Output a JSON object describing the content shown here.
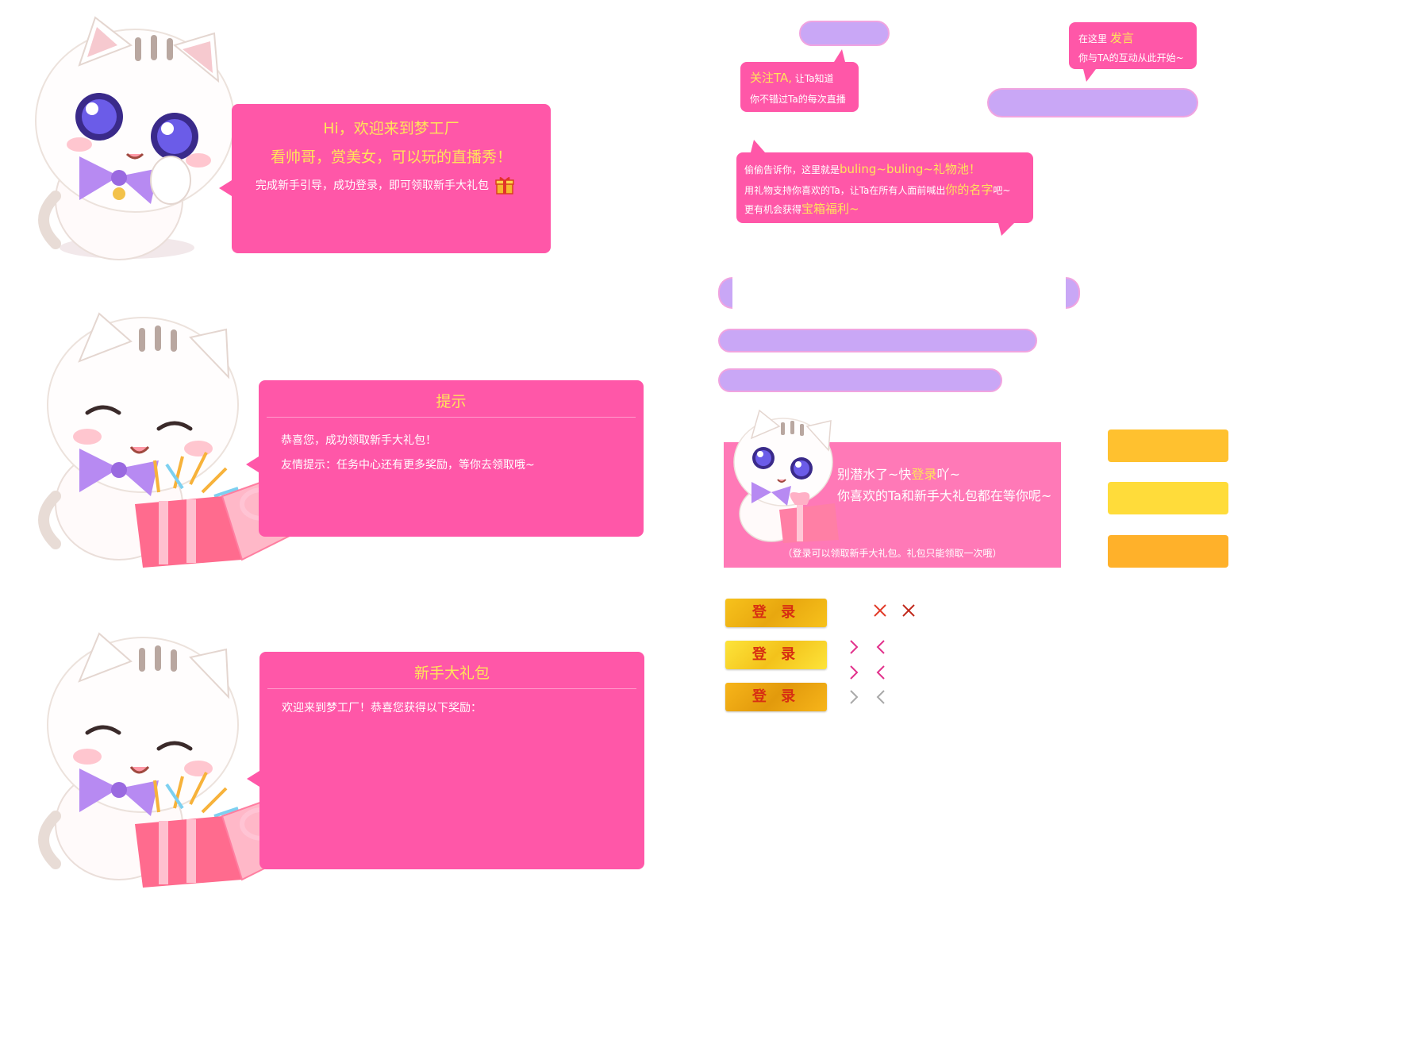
{
  "welcome": {
    "line1": "Hi，欢迎来到梦工厂",
    "line2": "看帅哥，赏美女，可以玩的直播秀！",
    "line3": "完成新手引导，成功登录，即可领取新手大礼包"
  },
  "tip_dialog": {
    "title": "提示",
    "line1": "恭喜您，成功领取新手大礼包！",
    "line2": "友情提示：任务中心还有更多奖励，等你去领取哦~"
  },
  "gift_dialog": {
    "title": "新手大礼包",
    "line1": "欢迎来到梦工厂！恭喜您获得以下奖励："
  },
  "follow_bubble": {
    "highlight": "关注TA,",
    "rest1": " 让Ta知道",
    "line2": "你不错过Ta的每次直播"
  },
  "speak_bubble": {
    "prefix": "在这里 ",
    "highlight": "发言",
    "line2": "你与TA的互动从此开始~"
  },
  "gift_pool_bubble": {
    "l1_prefix": "偷偷告诉你，这里就是",
    "l1_highlight": "buling~buling~礼物池！",
    "l2_prefix": "用礼物支持你喜欢的Ta，让Ta在所有人面前喊出",
    "l2_highlight": "你的名字",
    "l2_suffix": "吧~",
    "l3_prefix": "更有机会获得",
    "l3_highlight": "宝箱福利~"
  },
  "login_prompt": {
    "l1_prefix": "别潜水了~快",
    "l1_highlight": "登录",
    "l1_suffix": "吖~",
    "line2": "你喜欢的Ta和新手大礼包都在等你呢~",
    "note": "（登录可以领取新手大礼包。礼包只能领取一次哦）"
  },
  "buttons": {
    "login_label": "登录",
    "login_states": [
      "登 录",
      "登 录",
      "登 录"
    ]
  },
  "colors": {
    "pink": "#ff57a8",
    "yellow_text": "#ffe45a",
    "lavender": "#c9a7f6",
    "swatch1": "#ffc12f",
    "swatch2": "#ffdc3a",
    "swatch3": "#ffb12a"
  },
  "icons": {
    "close": "×",
    "next": "›",
    "prev": "‹"
  }
}
